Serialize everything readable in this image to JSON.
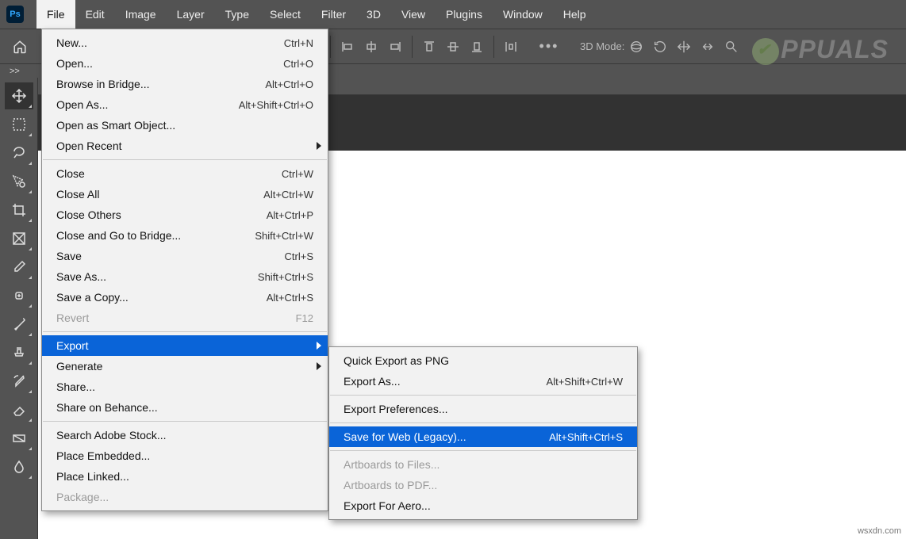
{
  "app": {
    "short": "Ps"
  },
  "menubar": {
    "items": [
      "File",
      "Edit",
      "Image",
      "Layer",
      "Type",
      "Select",
      "Filter",
      "3D",
      "View",
      "Plugins",
      "Window",
      "Help"
    ],
    "active_index": 0
  },
  "optionsbar": {
    "mode_label": "3D Mode:",
    "more": "•••"
  },
  "collapse": {
    "glyph": ">>"
  },
  "watermark": {
    "text": "PPUALS"
  },
  "footer": {
    "text": "wsxdn.com"
  },
  "file_menu": {
    "groups": [
      [
        {
          "label": "New...",
          "shortcut": "Ctrl+N"
        },
        {
          "label": "Open...",
          "shortcut": "Ctrl+O"
        },
        {
          "label": "Browse in Bridge...",
          "shortcut": "Alt+Ctrl+O"
        },
        {
          "label": "Open As...",
          "shortcut": "Alt+Shift+Ctrl+O"
        },
        {
          "label": "Open as Smart Object..."
        },
        {
          "label": "Open Recent",
          "submenu": true
        }
      ],
      [
        {
          "label": "Close",
          "shortcut": "Ctrl+W"
        },
        {
          "label": "Close All",
          "shortcut": "Alt+Ctrl+W"
        },
        {
          "label": "Close Others",
          "shortcut": "Alt+Ctrl+P"
        },
        {
          "label": "Close and Go to Bridge...",
          "shortcut": "Shift+Ctrl+W"
        },
        {
          "label": "Save",
          "shortcut": "Ctrl+S"
        },
        {
          "label": "Save As...",
          "shortcut": "Shift+Ctrl+S"
        },
        {
          "label": "Save a Copy...",
          "shortcut": "Alt+Ctrl+S"
        },
        {
          "label": "Revert",
          "shortcut": "F12",
          "disabled": true
        }
      ],
      [
        {
          "label": "Export",
          "submenu": true,
          "highlight": true
        },
        {
          "label": "Generate",
          "submenu": true
        },
        {
          "label": "Share..."
        },
        {
          "label": "Share on Behance..."
        }
      ],
      [
        {
          "label": "Search Adobe Stock..."
        },
        {
          "label": "Place Embedded..."
        },
        {
          "label": "Place Linked..."
        },
        {
          "label": "Package...",
          "disabled": true
        }
      ]
    ]
  },
  "export_submenu": {
    "groups": [
      [
        {
          "label": "Quick Export as PNG"
        },
        {
          "label": "Export As...",
          "shortcut": "Alt+Shift+Ctrl+W"
        }
      ],
      [
        {
          "label": "Export Preferences..."
        }
      ],
      [
        {
          "label": "Save for Web (Legacy)...",
          "shortcut": "Alt+Shift+Ctrl+S",
          "highlight": true
        }
      ],
      [
        {
          "label": "Artboards to Files...",
          "disabled": true
        },
        {
          "label": "Artboards to PDF...",
          "disabled": true
        },
        {
          "label": "Export For Aero..."
        }
      ]
    ]
  },
  "tools": [
    {
      "name": "move-tool",
      "active": true
    },
    {
      "name": "marquee-tool"
    },
    {
      "name": "lasso-tool"
    },
    {
      "name": "quick-select-tool"
    },
    {
      "name": "crop-tool"
    },
    {
      "name": "frame-tool"
    },
    {
      "name": "eyedropper-tool"
    },
    {
      "name": "healing-brush-tool"
    },
    {
      "name": "brush-tool"
    },
    {
      "name": "clone-stamp-tool"
    },
    {
      "name": "history-brush-tool"
    },
    {
      "name": "eraser-tool"
    },
    {
      "name": "gradient-tool"
    },
    {
      "name": "blur-tool"
    }
  ]
}
